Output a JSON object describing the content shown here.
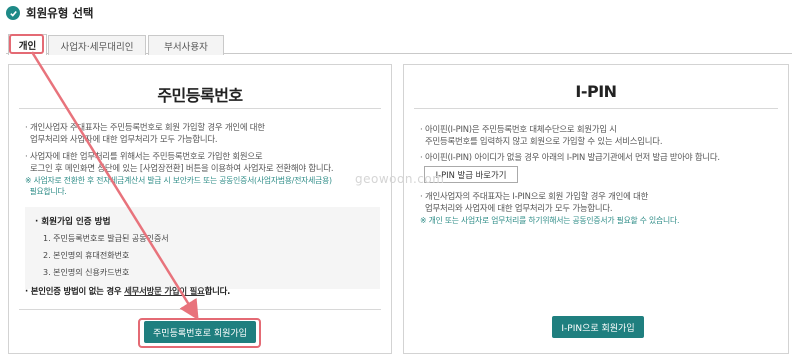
{
  "page": {
    "title": "회원유형 선택",
    "accent_color": "#1f7f7f",
    "highlight_color": "#e46a74"
  },
  "tabs": [
    {
      "label": "개인",
      "active": true
    },
    {
      "label": "사업자·세무대리인",
      "active": false
    },
    {
      "label": "부서사용자",
      "active": false
    }
  ],
  "left": {
    "title": "주민등록번호",
    "bullet1_line1": "개인사업자 주대표자는 주민등록번호로 회원 가입할 경우 개인에 대한",
    "bullet1_line2": "업무처리와 사업자에 대한 업무처리가 모두 가능합니다.",
    "bullet2_line1": "사업자에 대한 업무처리를 위해서는 주민등록번호로 가입한 회원으로",
    "bullet2_line2": "로그인 후 메인화면 상단에 있는 [사업장전환] 버튼을 이용하여 사업자로 전환해야 합니다.",
    "note_line1": "※ 사업자로 전환한 후 전자세금계산서 발급 시 보안카드 또는 공동인증서(사업자범용/전자세금용)",
    "note_line2": "필요합니다.",
    "cert_title": "회원가입 인증 방법",
    "cert_items": [
      "1. 주민등록번호로 발급된 공동인증서",
      "2. 본인명의 휴대전화번호",
      "3. 본인명의 신용카드번호"
    ],
    "bottom_prefix": "본인인증 방법이 없는 경우 ",
    "bottom_link": "세무서방문 가입이 필요",
    "bottom_suffix": "합니다.",
    "button": "주민등록번호로 회원가입"
  },
  "right": {
    "title": "I-PIN",
    "bullet1_line1": "아이핀(I-PIN)은 주민등록번호 대체수단으로 회원가입 시",
    "bullet1_line2": "주민등록번호를 입력하지 않고 회원으로 가입할 수 있는 서비스입니다.",
    "bullet2": "아이핀(I-PIN) 아이디가 없을 경우 아래의 I-PIN 발급기관에서 먼저 발급 받아야 합니다.",
    "issue_button": "I-PIN 발급 바로가기",
    "bullet3_line1": "개인사업자의 주대표자는 I-PIN으로 회원 가입할 경우 개인에 대한",
    "bullet3_line2": "업무처리와 사업자에 대한 업무처리가 모두 가능합니다.",
    "note": "※ 개인 또는 사업자로 업무처리를 하기위해서는 공동인증서가 필요할 수 있습니다.",
    "button": "I-PIN으로 회원가입"
  },
  "watermark": "geowoon.com"
}
